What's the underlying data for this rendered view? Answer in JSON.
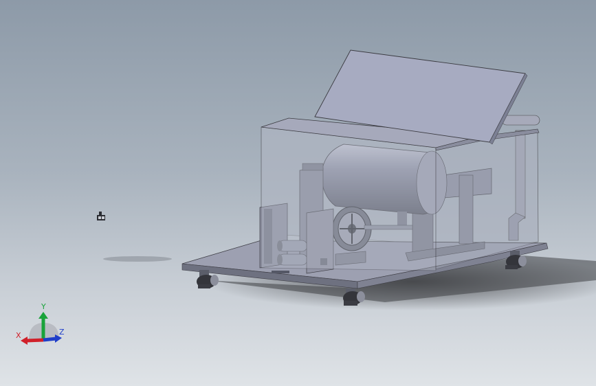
{
  "triad": {
    "x_label": "X",
    "y_label": "Y",
    "z_label": "Z",
    "colors": {
      "x": "#d0202a",
      "y": "#19a33a",
      "z": "#1f3ec9"
    }
  },
  "icons": {
    "model": "cad-assembly-model",
    "triad": "coordinate-triad-icon",
    "origin": "origin-marker-icon"
  },
  "colors": {
    "sheet_metal": "#9c9fb0",
    "sheet_dark": "#70737f",
    "glass": "#b7bdc8",
    "lid": "#a9adc2"
  }
}
